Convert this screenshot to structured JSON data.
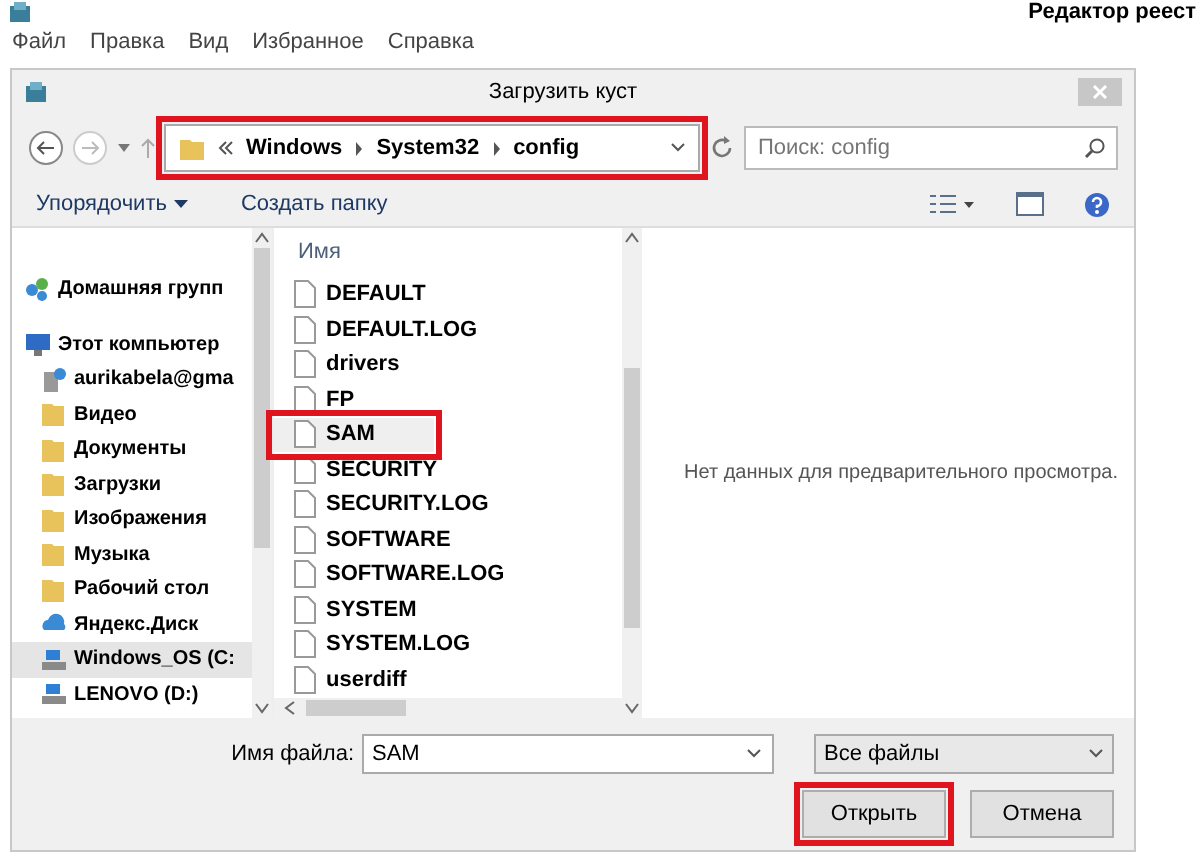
{
  "app": {
    "title": "Редактор реест",
    "menu": [
      "Файл",
      "Правка",
      "Вид",
      "Избранное",
      "Справка"
    ]
  },
  "dialog": {
    "title": "Загрузить куст",
    "address": {
      "path": [
        "Windows",
        "System32",
        "config"
      ],
      "highlighted": true
    },
    "search": {
      "placeholder": "Поиск: config"
    },
    "toolbar": [
      "Упорядочить",
      "Создать папку"
    ],
    "nav": [
      {
        "label": "Домашняя групп",
        "kind": "homegroup",
        "selected": false
      },
      {
        "label": "Этот компьютер",
        "kind": "computer",
        "selected": false
      },
      {
        "label": "aurikabela@gma",
        "kind": "network",
        "selected": false
      },
      {
        "label": "Видео",
        "kind": "folder",
        "selected": false
      },
      {
        "label": "Документы",
        "kind": "folder",
        "selected": false
      },
      {
        "label": "Загрузки",
        "kind": "folder",
        "selected": false
      },
      {
        "label": "Изображения",
        "kind": "folder",
        "selected": false
      },
      {
        "label": "Музыка",
        "kind": "folder",
        "selected": false
      },
      {
        "label": "Рабочий стол",
        "kind": "folder",
        "selected": false
      },
      {
        "label": "Яндекс.Диск",
        "kind": "cloud",
        "selected": false
      },
      {
        "label": "Windows_OS (C:",
        "kind": "drive",
        "selected": true
      },
      {
        "label": "LENOVO (D:)",
        "kind": "drive",
        "selected": false
      }
    ],
    "files_column": "Имя",
    "files": [
      {
        "name": "DEFAULT",
        "selected": false,
        "highlighted": false
      },
      {
        "name": "DEFAULT.LOG",
        "selected": false,
        "highlighted": false
      },
      {
        "name": "drivers",
        "selected": false,
        "highlighted": false
      },
      {
        "name": "FP",
        "selected": false,
        "highlighted": false
      },
      {
        "name": "SAM",
        "selected": true,
        "highlighted": true
      },
      {
        "name": "SECURITY",
        "selected": false,
        "highlighted": false
      },
      {
        "name": "SECURITY.LOG",
        "selected": false,
        "highlighted": false
      },
      {
        "name": "SOFTWARE",
        "selected": false,
        "highlighted": false
      },
      {
        "name": "SOFTWARE.LOG",
        "selected": false,
        "highlighted": false
      },
      {
        "name": "SYSTEM",
        "selected": false,
        "highlighted": false
      },
      {
        "name": "SYSTEM.LOG",
        "selected": false,
        "highlighted": false
      },
      {
        "name": "userdiff",
        "selected": false,
        "highlighted": false
      }
    ],
    "preview_message": "Нет данных для предварительного просмотра.",
    "filename_label": "Имя файла:",
    "filename_value": "SAM",
    "filter": "Все файлы",
    "buttons": [
      {
        "label": "Открыть",
        "highlighted": true
      },
      {
        "label": "Отмена",
        "highlighted": false
      }
    ]
  }
}
